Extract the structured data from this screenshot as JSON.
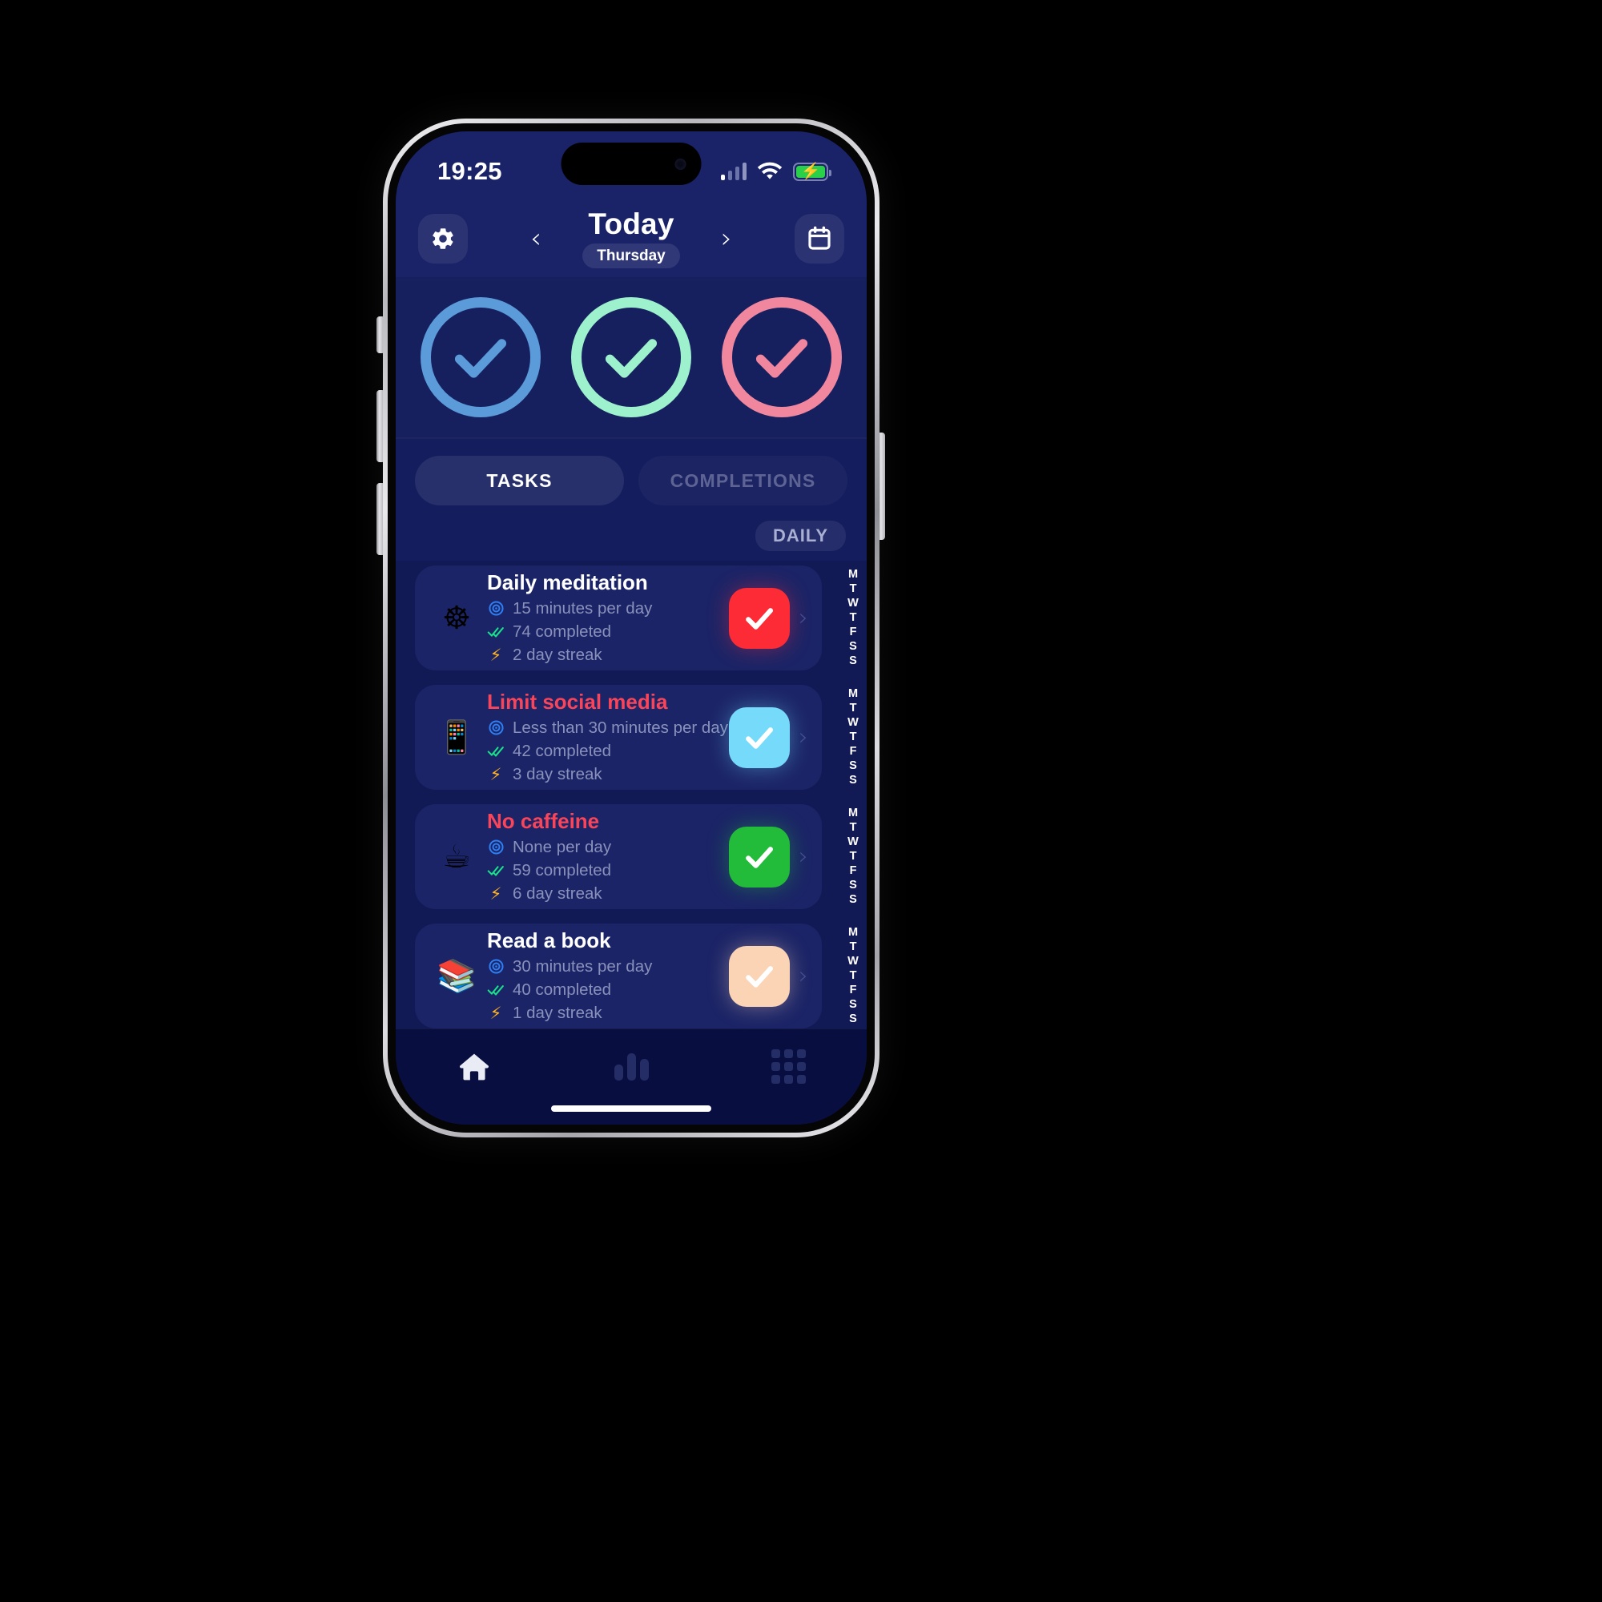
{
  "status_bar": {
    "time": "19:25",
    "signal_icon": "cellular-signal-icon",
    "wifi_icon": "wifi-icon",
    "battery_icon": "battery-charging-icon",
    "battery_charging": true
  },
  "header": {
    "settings_icon": "gear-icon",
    "calendar_icon": "calendar-icon",
    "prev_label": "‹",
    "next_label": "›",
    "title": "Today",
    "weekday": "Thursday"
  },
  "progress_rings": [
    {
      "name": "ring-blue",
      "color": "#5b9bd9",
      "state": "complete",
      "check_icon": "check-icon"
    },
    {
      "name": "ring-mint",
      "color": "#9df2cd",
      "state": "complete",
      "check_icon": "check-icon"
    },
    {
      "name": "ring-pink",
      "color": "#f1869f",
      "state": "complete",
      "check_icon": "check-icon"
    }
  ],
  "tabs": [
    {
      "label": "TASKS",
      "active": true
    },
    {
      "label": "COMPLETIONS",
      "active": false
    }
  ],
  "filter_badge": {
    "label": "DAILY"
  },
  "week_letters": [
    "M",
    "T",
    "W",
    "T",
    "F",
    "S",
    "S"
  ],
  "tasks": [
    {
      "title": "Daily meditation",
      "title_kind": "good",
      "emoji": "☸",
      "emoji_name": "dharma-wheel-icon",
      "emoji_bg": "#a342d6",
      "goal_icon": "target-icon",
      "goal": "15 minutes per day",
      "completed_icon": "double-check-icon",
      "completed": "74 completed",
      "streak_icon": "lightning-bolt-icon",
      "streak": "2 day streak",
      "check_color": "#fc2b36",
      "check_icon": "check-icon",
      "chevron": "›"
    },
    {
      "title": "Limit social media",
      "title_kind": "bad",
      "emoji": "📱",
      "emoji_name": "mobile-phone-icon",
      "emoji_bg": "#202a3a",
      "goal_icon": "target-icon",
      "goal": "Less than 30 minutes per day",
      "completed_icon": "double-check-icon",
      "completed": "42 completed",
      "streak_icon": "lightning-bolt-icon",
      "streak": "3 day streak",
      "check_color": "#76dbfb",
      "check_icon": "check-icon",
      "chevron": "›"
    },
    {
      "title": "No caffeine",
      "title_kind": "bad",
      "emoji": "☕",
      "emoji_name": "hot-beverage-icon",
      "emoji_bg": "#efe7dd",
      "goal_icon": "target-icon",
      "goal": "None per day",
      "completed_icon": "double-check-icon",
      "completed": "59 completed",
      "streak_icon": "lightning-bolt-icon",
      "streak": "6 day streak",
      "check_color": "#22bb3a",
      "check_icon": "check-icon",
      "chevron": "›"
    },
    {
      "title": "Read a book",
      "title_kind": "good",
      "emoji": "📚",
      "emoji_name": "books-icon",
      "emoji_bg": "#2f8a3e",
      "goal_icon": "target-icon",
      "goal": "30 minutes per day",
      "completed_icon": "double-check-icon",
      "completed": "40 completed",
      "streak_icon": "lightning-bolt-icon",
      "streak": "1 day streak",
      "check_color": "#fad4b4",
      "check_icon": "check-icon",
      "chevron": "›"
    }
  ],
  "bottom_nav": [
    {
      "name": "nav-home",
      "icon": "home-icon",
      "active": true
    },
    {
      "name": "nav-stats",
      "icon": "bar-chart-icon",
      "active": false
    },
    {
      "name": "nav-all-tasks",
      "icon": "grid-icon",
      "active": false
    }
  ],
  "colors": {
    "screen_bg": "#121a56",
    "header_bg": "#1a2268",
    "card_bg": "#1b2467",
    "nav_bg": "#080f40",
    "muted_text": "#8a91bb",
    "danger": "#f9455a"
  }
}
